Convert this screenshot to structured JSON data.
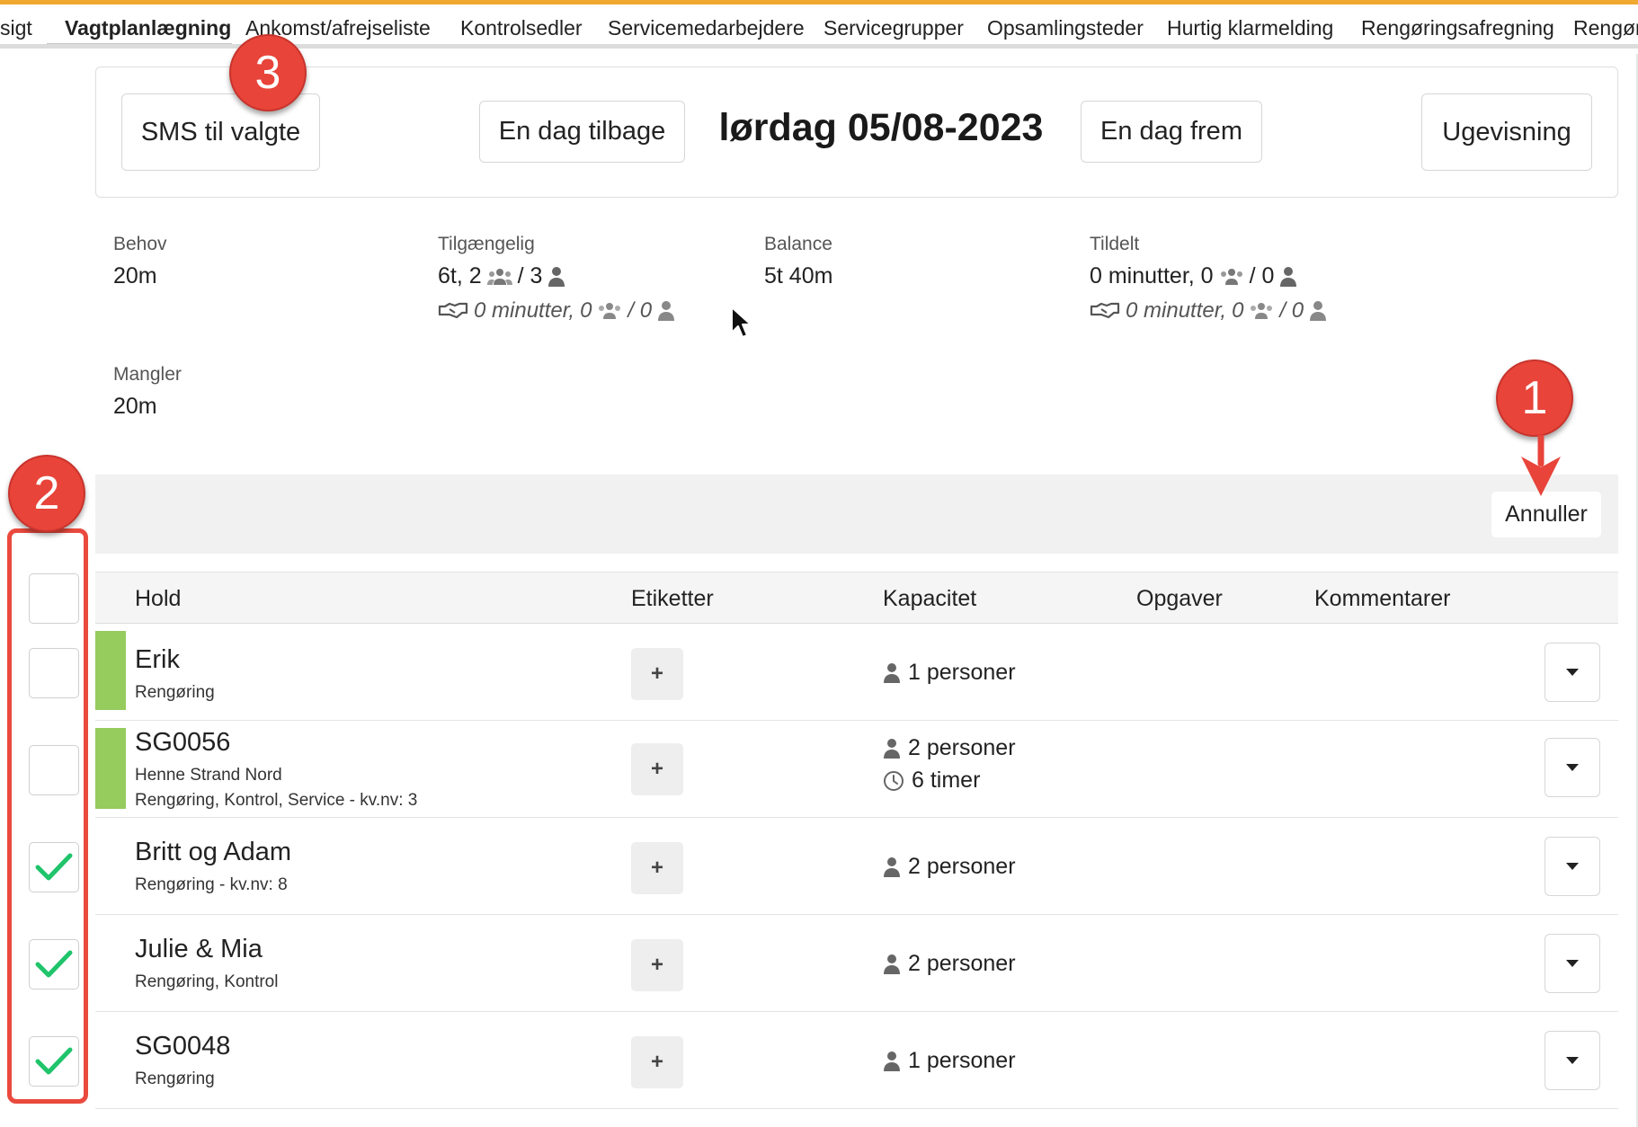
{
  "nav": {
    "tabs": [
      {
        "label": "sigt",
        "active": false
      },
      {
        "label": "Vagtplanlægning",
        "active": true
      },
      {
        "label": "Ankomst/afrejseliste",
        "active": false
      },
      {
        "label": "Kontrolsedler",
        "active": false
      },
      {
        "label": "Servicemedarbejdere",
        "active": false
      },
      {
        "label": "Servicegrupper",
        "active": false
      },
      {
        "label": "Opsamlingsteder",
        "active": false
      },
      {
        "label": "Hurtig klarmelding",
        "active": false
      },
      {
        "label": "Rengøringsafregning",
        "active": false
      },
      {
        "label": "Rengør",
        "active": false
      }
    ]
  },
  "header": {
    "sms_button": "SMS til valgte",
    "prev_day_button": "En dag tilbage",
    "date_title": "lørdag 05/08-2023",
    "next_day_button": "En dag frem",
    "week_view_button": "Ugevisning"
  },
  "stats": {
    "behov": {
      "label": "Behov",
      "value": "20m"
    },
    "tilgaengelig": {
      "label": "Tilgængelig",
      "value_prefix": "6t,  2",
      "value_sep": "/ 3",
      "sub_text": "0 minutter,",
      "sub_groups": "0",
      "sub_sep": "/ 0"
    },
    "balance": {
      "label": "Balance",
      "value": "5t 40m"
    },
    "tildelt": {
      "label": "Tildelt",
      "value_prefix": "0 minutter,  0",
      "value_sep": "/ 0",
      "sub_text": "0 minutter,",
      "sub_groups": "0",
      "sub_sep": "/ 0"
    },
    "mangler": {
      "label": "Mangler",
      "value": "20m"
    }
  },
  "toolbar": {
    "cancel_button": "Annuller"
  },
  "table": {
    "headers": {
      "hold": "Hold",
      "etiketter": "Etiketter",
      "kapacitet": "Kapacitet",
      "opgaver": "Opgaver",
      "kommentarer": "Kommentarer"
    },
    "plus_label": "+",
    "rows": [
      {
        "name": "Erik",
        "sub1": "Rengøring",
        "sub2": "",
        "capacity": "1 personer",
        "hours": "",
        "checked": false,
        "color": "#96cb5e"
      },
      {
        "name": "SG0056",
        "sub1": "Henne Strand Nord",
        "sub2": "Rengøring, Kontrol, Service - kv.nv: 3",
        "capacity": "2 personer",
        "hours": "6 timer",
        "checked": false,
        "color": "#96cb5e"
      },
      {
        "name": "Britt og Adam",
        "sub1": "Rengøring - kv.nv: 8",
        "sub2": "",
        "capacity": "2 personer",
        "hours": "",
        "checked": true,
        "color": ""
      },
      {
        "name": "Julie & Mia",
        "sub1": "Rengøring, Kontrol",
        "sub2": "",
        "capacity": "2 personer",
        "hours": "",
        "checked": true,
        "color": ""
      },
      {
        "name": "SG0048",
        "sub1": "Rengøring",
        "sub2": "",
        "capacity": "1 personer",
        "hours": "",
        "checked": true,
        "color": ""
      }
    ]
  },
  "annotations": {
    "badge1": "1",
    "badge2": "2",
    "badge3": "3",
    "color": "#e8443a"
  },
  "colors": {
    "accent_bar": "#f0a830",
    "team_color": "#96cb5e",
    "check": "#1fc46b"
  }
}
